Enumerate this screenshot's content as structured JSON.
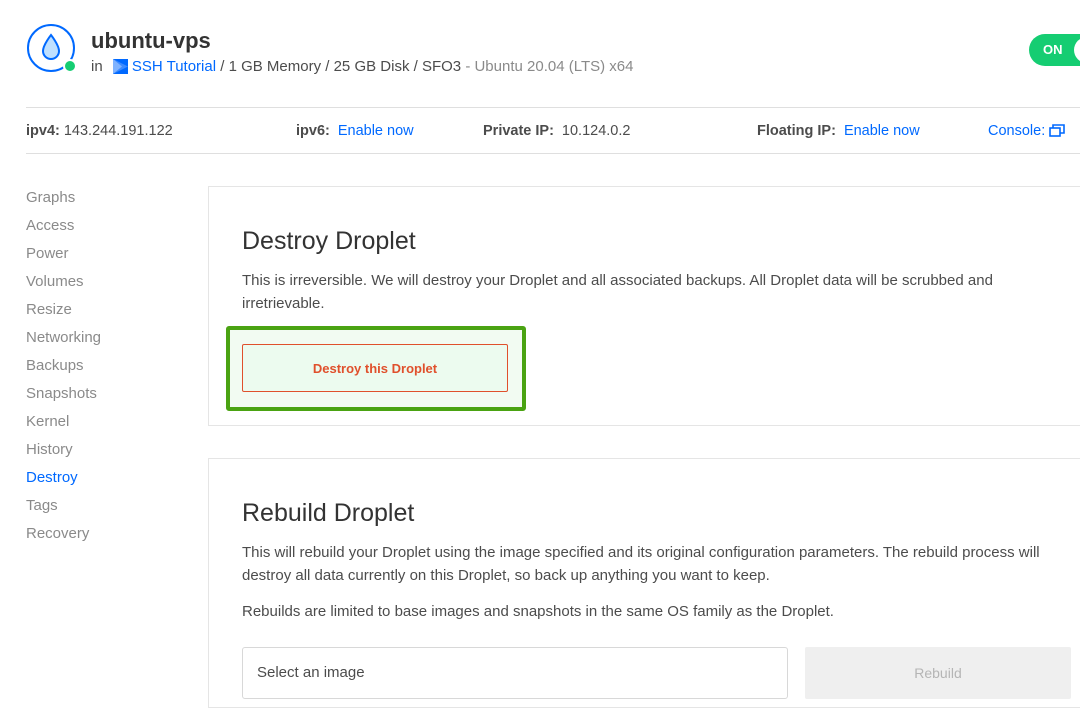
{
  "header": {
    "droplet_name": "ubuntu-vps",
    "in_label": "in",
    "project_name": "SSH Tutorial",
    "specs": "/ 1 GB Memory / 25 GB Disk / SFO3",
    "image": "- Ubuntu 20.04 (LTS) x64",
    "power_state": "ON",
    "logo_icon": "droplet-icon",
    "status_color": "#15cd72"
  },
  "info_bar": {
    "ipv4_label": "ipv4:",
    "ipv4_value": "143.244.191.122",
    "ipv6_label": "ipv6:",
    "ipv6_link": "Enable now",
    "private_ip_label": "Private IP:",
    "private_ip_value": "10.124.0.2",
    "floating_ip_label": "Floating IP:",
    "floating_ip_link": "Enable now",
    "console_label": "Console:",
    "console_icon": "external-window-icon"
  },
  "sidebar": {
    "items": [
      {
        "label": "Graphs"
      },
      {
        "label": "Access"
      },
      {
        "label": "Power"
      },
      {
        "label": "Volumes"
      },
      {
        "label": "Resize"
      },
      {
        "label": "Networking"
      },
      {
        "label": "Backups"
      },
      {
        "label": "Snapshots"
      },
      {
        "label": "Kernel"
      },
      {
        "label": "History"
      },
      {
        "label": "Destroy",
        "active": true
      },
      {
        "label": "Tags"
      },
      {
        "label": "Recovery"
      }
    ]
  },
  "destroy": {
    "title": "Destroy Droplet",
    "description": "This is irreversible. We will destroy your Droplet and all associated backups. All Droplet data will be scrubbed and irretrievable.",
    "button_label": "Destroy this Droplet",
    "danger_color": "#e0502c",
    "highlight_color": "#4aa312"
  },
  "rebuild": {
    "title": "Rebuild Droplet",
    "description": "This will rebuild your Droplet using the image specified and its original configuration parameters. The rebuild process will destroy all data currently on this Droplet, so back up anything you want to keep.",
    "note": "Rebuilds are limited to base images and snapshots in the same OS family as the Droplet.",
    "select_placeholder": "Select an image",
    "button_label": "Rebuild"
  },
  "colors": {
    "accent": "#0069ff",
    "text": "#333333",
    "muted": "#8a8a8a"
  }
}
